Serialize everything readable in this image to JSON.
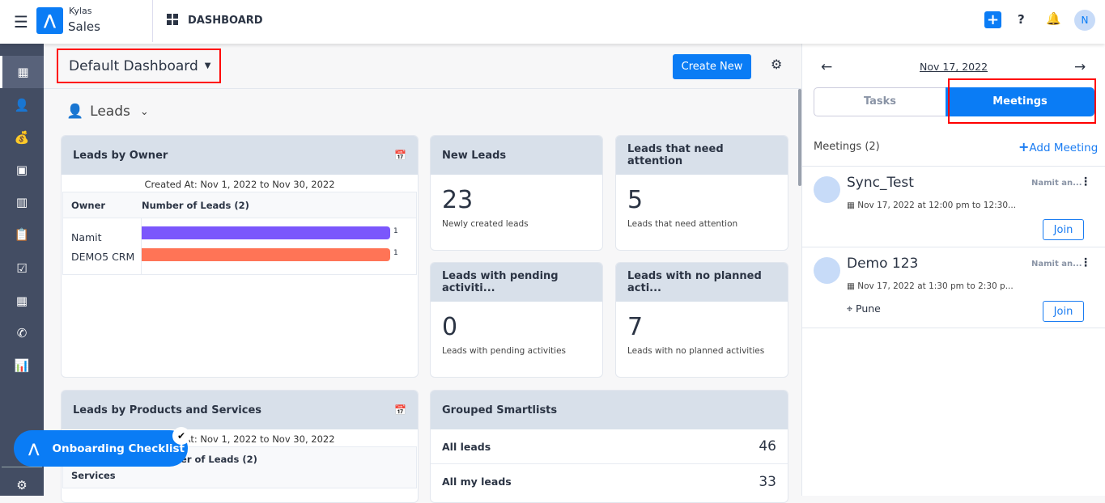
{
  "header": {
    "brand_top": "Kylas",
    "brand_bottom": "Sales",
    "page": "DASHBOARD"
  },
  "toolbar": {
    "dashboard_name": "Default Dashboard",
    "create_new": "Create New"
  },
  "section": {
    "title": "Leads"
  },
  "leads_by_owner": {
    "title": "Leads by Owner",
    "range": "Created At: Nov 1, 2022 to Nov 30, 2022",
    "col_owner": "Owner",
    "col_count": "Number of Leads (2)",
    "rows": [
      {
        "owner": "Namit",
        "value": "1",
        "color": "#7b57fc"
      },
      {
        "owner": "DEMO5 CRM",
        "value": "1",
        "color": "#ff7456"
      }
    ]
  },
  "stats": [
    {
      "title": "New Leads",
      "value": "23",
      "desc": "Newly created leads"
    },
    {
      "title": "Leads that need attention",
      "value": "5",
      "desc": "Leads that need attention"
    },
    {
      "title": "Leads with pending activiti...",
      "value": "0",
      "desc": "Leads with pending activities"
    },
    {
      "title": "Leads with no planned acti...",
      "value": "7",
      "desc": "Leads with no planned activities"
    }
  ],
  "leads_by_products": {
    "title": "Leads by Products and Services",
    "range": "Created At: Nov 1, 2022 to Nov 30, 2022",
    "col_product": "Services",
    "col_count": "Number of Leads (2)"
  },
  "smartlists": {
    "title": "Grouped Smartlists",
    "items": [
      {
        "label": "All leads",
        "count": "46"
      },
      {
        "label": "All my leads",
        "count": "33"
      }
    ]
  },
  "onboarding": {
    "label": "Onboarding Checklist"
  },
  "right_panel": {
    "date": "Nov 17, 2022",
    "tabs": [
      "Tasks",
      "Meetings"
    ],
    "active_tab": "Meetings",
    "count_label": "Meetings (2)",
    "add_label": "Add Meeting",
    "meetings": [
      {
        "title": "Sync_Test",
        "owner": "Namit an...",
        "time": "Nov 17, 2022 at 12:00 pm to 12:30...",
        "location": "",
        "join": "Join"
      },
      {
        "title": "Demo 123",
        "owner": "Namit an...",
        "time": "Nov 17, 2022 at 1:30 pm to 2:30 p...",
        "location": "Pune",
        "join": "Join"
      }
    ]
  },
  "user": {
    "initial": "N"
  },
  "colors": {
    "primary": "#0a7cf5",
    "sidebar": "#434d63",
    "highlight": "#ff0000"
  }
}
